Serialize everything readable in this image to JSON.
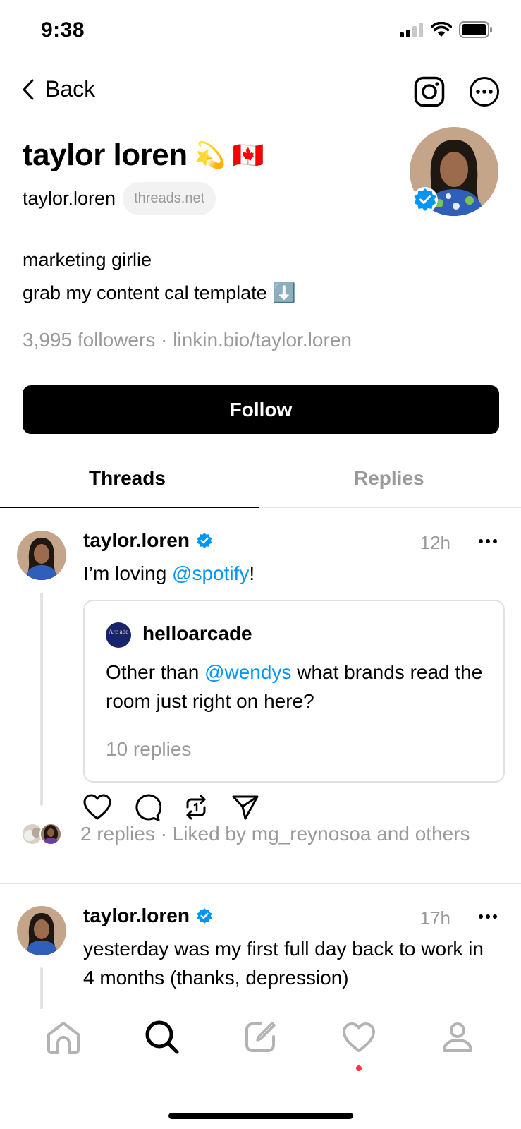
{
  "status": {
    "time": "9:38"
  },
  "nav": {
    "back_label": "Back"
  },
  "profile": {
    "name": "taylor loren",
    "name_emojis": "💫 🇨🇦",
    "handle": "taylor.loren",
    "domain_pill": "threads.net",
    "bio_line1": "marketing girlie",
    "bio_line2": "grab my content cal template ⬇️",
    "stats": "3,995 followers · linkin.bio/taylor.loren",
    "follow_label": "Follow"
  },
  "tabs": [
    {
      "label": "Threads",
      "active": true
    },
    {
      "label": "Replies",
      "active": false
    }
  ],
  "posts": [
    {
      "user": "taylor.loren",
      "time": "12h",
      "text_before": "I’m loving ",
      "mention": "@spotify",
      "text_after": "!",
      "quote": {
        "avatar_text": "Arc ade",
        "user": "helloarcade",
        "text_before": "Other than ",
        "mention": "@wendys",
        "text_after": " what brands read the room just right on here?",
        "replies": "10 replies"
      },
      "meta": "2 replies · Liked by mg_reynosoa and others"
    },
    {
      "user": "taylor.loren",
      "time": "17h",
      "text": "yesterday was my first full day back to work in 4 months (thanks, depression)"
    }
  ],
  "colors": {
    "accent": "#0095f6",
    "muted": "#999999",
    "notification": "#ff3040"
  },
  "bottom_nav": [
    "home-icon",
    "search-icon",
    "compose-icon",
    "heart-icon",
    "profile-icon"
  ]
}
